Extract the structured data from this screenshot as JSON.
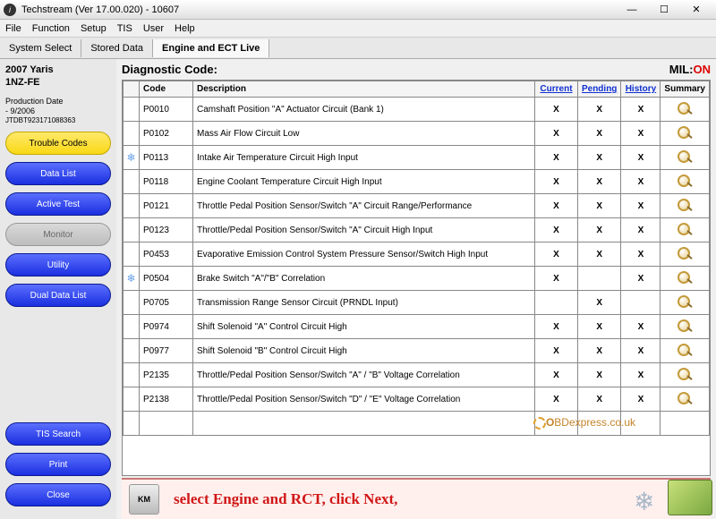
{
  "window": {
    "title": "Techstream (Ver 17.00.020) - 10607",
    "min": "—",
    "max": "☐",
    "close": "✕"
  },
  "menu": [
    "File",
    "Function",
    "Setup",
    "TIS",
    "User",
    "Help"
  ],
  "tabs": {
    "t0": "System Select",
    "t1": "Stored Data",
    "t2": "Engine and ECT Live"
  },
  "vehicle": {
    "model": "2007 Yaris",
    "engine": "1NZ-FE",
    "prod_label": "Production Date",
    "prod_value": "- 9/2006",
    "vin": "JTDBT923171088363"
  },
  "sidebar": {
    "trouble": "Trouble Codes",
    "datalist": "Data List",
    "active": "Active Test",
    "monitor": "Monitor",
    "utility": "Utility",
    "dual": "Dual Data List",
    "tis": "TIS Search",
    "print": "Print",
    "close": "Close"
  },
  "diag": {
    "heading": "Diagnostic Code:",
    "mil_lbl": "MIL:",
    "mil_val": "ON"
  },
  "headers": {
    "blank": "",
    "code": "Code",
    "desc": "Description",
    "current": "Current",
    "pending": "Pending",
    "history": "History",
    "summary": "Summary"
  },
  "rows": [
    {
      "snow": false,
      "code": "P0010",
      "desc": "Camshaft Position \"A\" Actuator Circuit (Bank 1)",
      "c": "X",
      "p": "X",
      "h": "X"
    },
    {
      "snow": false,
      "code": "P0102",
      "desc": "Mass Air Flow Circuit Low",
      "c": "X",
      "p": "X",
      "h": "X"
    },
    {
      "snow": true,
      "code": "P0113",
      "desc": "Intake Air Temperature Circuit High Input",
      "c": "X",
      "p": "X",
      "h": "X"
    },
    {
      "snow": false,
      "code": "P0118",
      "desc": "Engine Coolant Temperature Circuit High Input",
      "c": "X",
      "p": "X",
      "h": "X"
    },
    {
      "snow": false,
      "code": "P0121",
      "desc": "Throttle Pedal Position Sensor/Switch \"A\" Circuit Range/Performance",
      "c": "X",
      "p": "X",
      "h": "X"
    },
    {
      "snow": false,
      "code": "P0123",
      "desc": "Throttle/Pedal Position Sensor/Switch \"A\" Circuit High Input",
      "c": "X",
      "p": "X",
      "h": "X"
    },
    {
      "snow": false,
      "code": "P0453",
      "desc": "Evaporative Emission Control System Pressure Sensor/Switch High Input",
      "c": "X",
      "p": "X",
      "h": "X"
    },
    {
      "snow": true,
      "code": "P0504",
      "desc": "Brake Switch \"A\"/\"B\" Correlation",
      "c": "X",
      "p": "",
      "h": "X"
    },
    {
      "snow": false,
      "code": "P0705",
      "desc": "Transmission Range Sensor Circuit (PRNDL Input)",
      "c": "",
      "p": "X",
      "h": ""
    },
    {
      "snow": false,
      "code": "P0974",
      "desc": "Shift Solenoid \"A\" Control Circuit High",
      "c": "X",
      "p": "X",
      "h": "X"
    },
    {
      "snow": false,
      "code": "P0977",
      "desc": "Shift Solenoid \"B\" Control Circuit High",
      "c": "X",
      "p": "X",
      "h": "X"
    },
    {
      "snow": false,
      "code": "P2135",
      "desc": "Throttle/Pedal Position Sensor/Switch \"A\" / \"B\" Voltage Correlation",
      "c": "X",
      "p": "X",
      "h": "X"
    },
    {
      "snow": false,
      "code": "P2138",
      "desc": "Throttle/Pedal Position Sensor/Switch \"D\" / \"E\" Voltage Correlation",
      "c": "X",
      "p": "X",
      "h": "X"
    },
    {
      "snow": false,
      "code": "",
      "desc": "",
      "c": "",
      "p": "",
      "h": "",
      "nosum": true
    }
  ],
  "banner": "select Engine and RCT, click Next,",
  "watermark": "BDexpress.co.uk"
}
